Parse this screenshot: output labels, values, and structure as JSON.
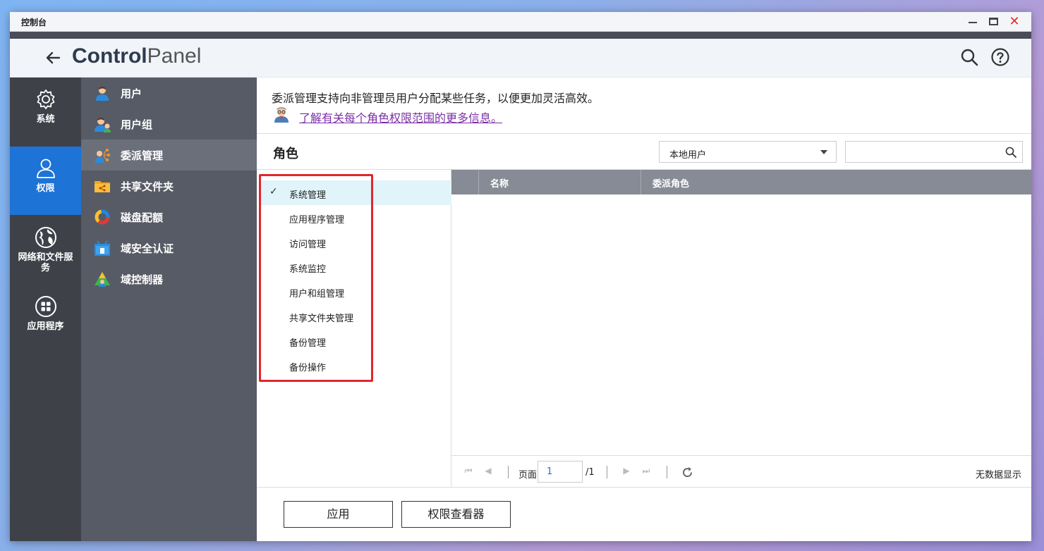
{
  "window": {
    "title": "控制台"
  },
  "header": {
    "title_bold": "Control",
    "title_light": "Panel"
  },
  "rail": {
    "items": [
      {
        "label": "系统",
        "icon": "gear-icon"
      },
      {
        "label": "权限",
        "icon": "user-icon",
        "active": true
      },
      {
        "label": "网络和文件服务",
        "icon": "globe-icon"
      },
      {
        "label": "应用程序",
        "icon": "apps-grid-icon"
      }
    ]
  },
  "subnav": {
    "items": [
      {
        "label": "用户",
        "icon": "user-icon"
      },
      {
        "label": "用户组",
        "icon": "user-group-icon"
      },
      {
        "label": "委派管理",
        "icon": "delegate-icon",
        "active": true
      },
      {
        "label": "共享文件夹",
        "icon": "shared-folder-icon"
      },
      {
        "label": "磁盘配额",
        "icon": "disk-quota-icon"
      },
      {
        "label": "域安全认证",
        "icon": "domain-security-icon"
      },
      {
        "label": "域控制器",
        "icon": "domain-controller-icon"
      }
    ]
  },
  "main": {
    "intro": "委派管理支持向非管理员用户分配某些任务，以便更加灵活高效。",
    "learn_more": "了解有关每个角色权限范围的更多信息。",
    "role_title": "角色",
    "user_type_select": "本地用户",
    "search_placeholder": "",
    "roles": [
      {
        "label": "系统管理",
        "selected": true
      },
      {
        "label": "应用程序管理"
      },
      {
        "label": "访问管理"
      },
      {
        "label": "系统监控"
      },
      {
        "label": "用户和组管理"
      },
      {
        "label": "共享文件夹管理"
      },
      {
        "label": "备份管理"
      },
      {
        "label": "备份操作"
      }
    ],
    "grid": {
      "columns": [
        "名称",
        "委派角色"
      ]
    },
    "pager": {
      "page_label": "页面",
      "page_value": "1",
      "page_total": "/1",
      "empty_text": "无数据显示"
    },
    "buttons": {
      "apply": "应用",
      "permission_viewer": "权限查看器"
    }
  },
  "colors": {
    "accent": "#1d73d6",
    "rail_bg": "#3f4149",
    "subnav_bg": "#575b65",
    "highlight_red": "#e0272c",
    "link": "#7b2fa6"
  }
}
